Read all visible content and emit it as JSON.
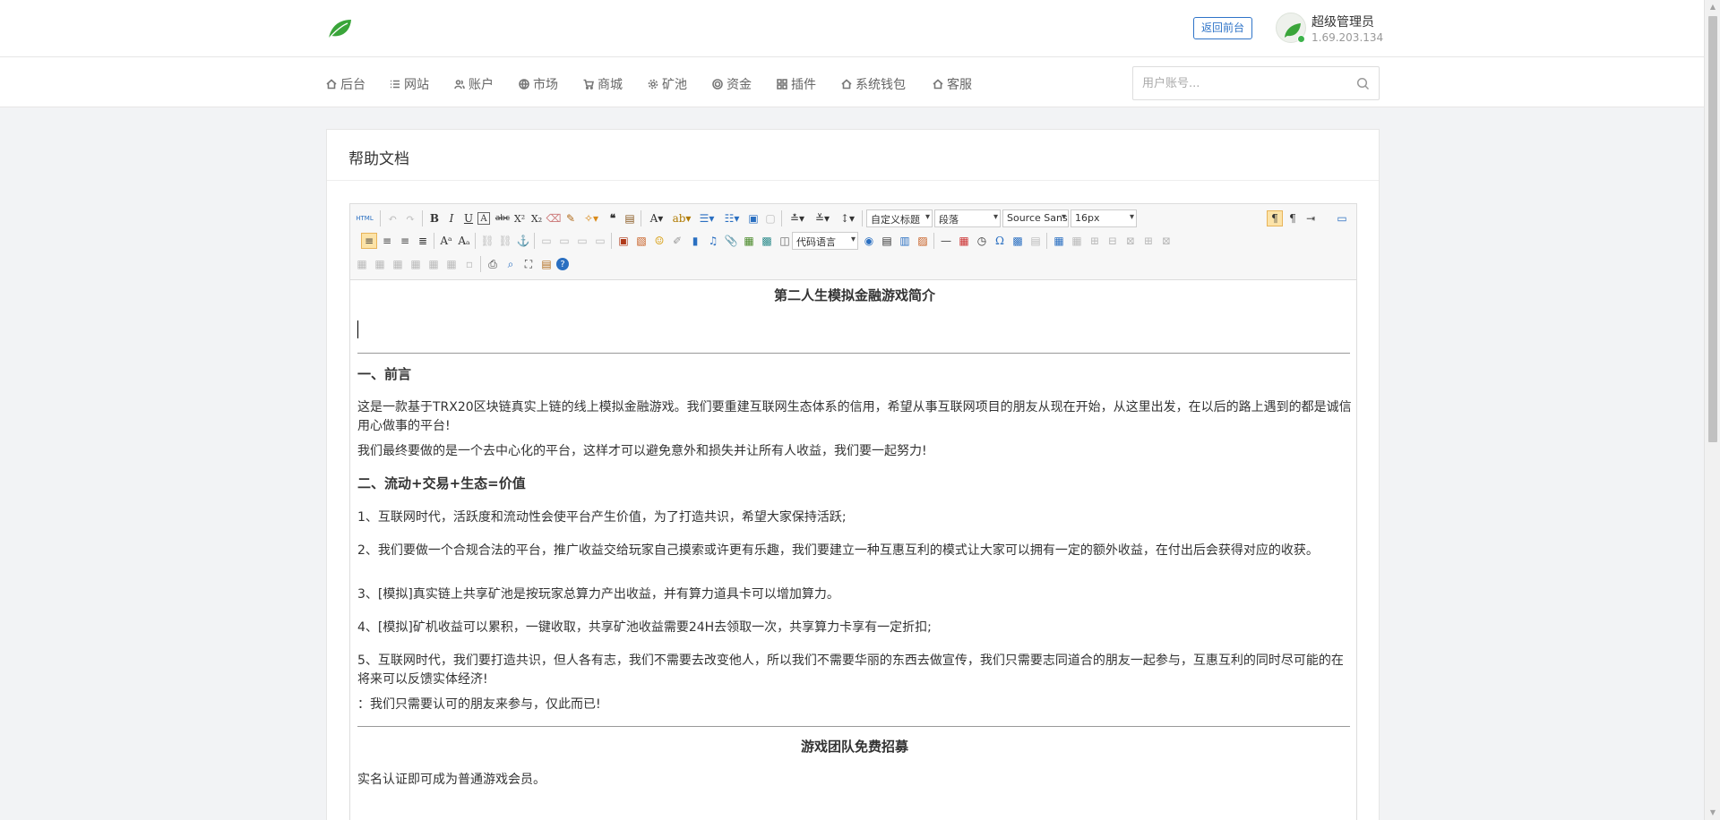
{
  "header": {
    "front_button": "返回前台",
    "user_name": "超级管理员",
    "user_ip": "1.69.203.134"
  },
  "nav": {
    "items": [
      {
        "label": "后台",
        "icon": "home-icon"
      },
      {
        "label": "网站",
        "icon": "list-icon"
      },
      {
        "label": "账户",
        "icon": "users-icon"
      },
      {
        "label": "市场",
        "icon": "globe-icon"
      },
      {
        "label": "商城",
        "icon": "cart-icon"
      },
      {
        "label": "矿池",
        "icon": "gear-icon"
      },
      {
        "label": "资金",
        "icon": "coin-icon"
      },
      {
        "label": "插件",
        "icon": "grid-icon"
      },
      {
        "label": "系统钱包",
        "icon": "home-icon"
      },
      {
        "label": "客服",
        "icon": "home-icon"
      }
    ]
  },
  "search": {
    "placeholder": "用户账号..."
  },
  "panel": {
    "title": "帮助文档"
  },
  "toolbar": {
    "custom_heading": "自定义标题",
    "paragraph": "段落",
    "font_family": "Source Sans",
    "font_size": "16px",
    "code_language": "代码语言",
    "source_label": "HTML"
  },
  "content": {
    "title": "第二人生模拟金融游戏简介",
    "h1": "一、前言",
    "p1": "这是一款基于TRX20区块链真实上链的线上模拟金融游戏。我们要重建互联网生态体系的信用，希望从事互联网项目的朋友从现在开始，从这里出发，在以后的路上遇到的都是诚信用心做事的平台!",
    "p2": "我们最终要做的是一个去中心化的平台，这样才可以避免意外和损失并让所有人收益，我们要一起努力!",
    "h2": "二、流动+交易+生态=价值",
    "p3": "1、互联网时代，活跃度和流动性会使平台产生价值，为了打造共识，希望大家保持活跃;",
    "p4": "2、我们要做一个合规合法的平台，推广收益交给玩家自己摸索或许更有乐趣，我们要建立一种互惠互利的模式让大家可以拥有一定的额外收益，在付出后会获得对应的收获。",
    "p5": "3、[模拟]真实链上共享矿池是按玩家总算力产出收益，并有算力道具卡可以增加算力。",
    "p6": "4、[模拟]矿机收益可以累积，一键收取，共享矿池收益需要24H去领取一次，共享算力卡享有一定折扣;",
    "p7": "5、互联网时代，我们要打造共识，但人各有志，我们不需要去改变他人，所以我们不需要华丽的东西去做宣传，我们只需要志同道合的朋友一起参与，互惠互利的同时尽可能的在将来可以反馈实体经济!",
    "p8": "：我们只需要认可的朋友来参与，仅此而已!",
    "title2": "游戏团队免费招募",
    "p9": "实名认证即可成为普通游戏会员。"
  }
}
